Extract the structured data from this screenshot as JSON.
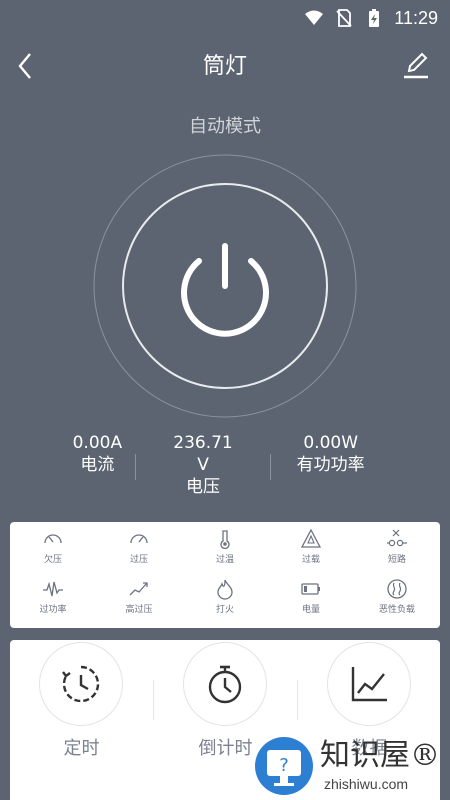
{
  "status_bar": {
    "time": "11:29"
  },
  "header": {
    "title": "筒灯"
  },
  "mode": "自动模式",
  "readings": [
    {
      "value": "0.00A",
      "label": "电流"
    },
    {
      "value": "236.71 V",
      "label": "电压"
    },
    {
      "value": "0.00W",
      "label": "有功功率"
    }
  ],
  "warnings": [
    {
      "label": "欠压",
      "icon": "gauge-low-icon"
    },
    {
      "label": "过压",
      "icon": "gauge-high-icon"
    },
    {
      "label": "过温",
      "icon": "thermometer-icon"
    },
    {
      "label": "过载",
      "icon": "overload-triangle-icon"
    },
    {
      "label": "短路",
      "icon": "short-circuit-icon"
    },
    {
      "label": "过功率",
      "icon": "power-wave-icon"
    },
    {
      "label": "高过压",
      "icon": "rising-trend-icon"
    },
    {
      "label": "打火",
      "icon": "fire-icon"
    },
    {
      "label": "电量",
      "icon": "battery-icon"
    },
    {
      "label": "恶性负载",
      "icon": "malignant-load-icon"
    }
  ],
  "functions": [
    {
      "label": "定时",
      "icon": "timer-icon"
    },
    {
      "label": "倒计时",
      "icon": "stopwatch-icon"
    },
    {
      "label": "数据",
      "icon": "line-chart-icon"
    }
  ],
  "watermark": {
    "title": "知识屋®",
    "url": "zhishiwu.com"
  }
}
